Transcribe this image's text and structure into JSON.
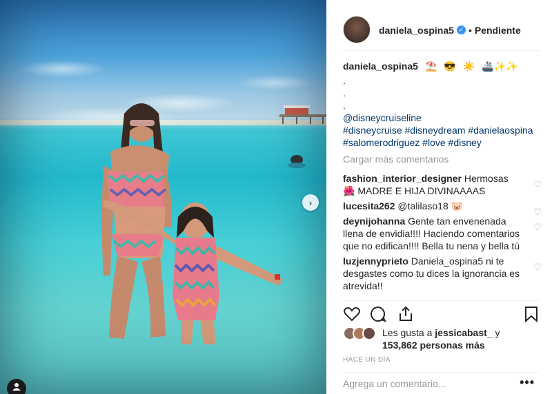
{
  "post": {
    "username": "daniela_ospina5",
    "verified_icon": "verified-badge-icon",
    "follow_state": "Pendiente",
    "caption_emojis": [
      "⛱️",
      "😎",
      "☀️",
      "🚢✨✨"
    ],
    "caption_dots": [
      ".",
      ".",
      "."
    ],
    "caption_lines": [
      "@disneycruiseline",
      "#disneycruise #disneydream #danielaospina",
      "#salomerodriguez #love #disney"
    ],
    "load_more": "Cargar más comentarios",
    "comments": [
      {
        "user": "fashion_interior_designer",
        "text": "Hermosas 🌺 MADRE E HIJA DIVINAAAAS"
      },
      {
        "user": "lucesita262",
        "text": "@talilaso18 🐷"
      },
      {
        "user": "deynijohanna",
        "text": "Gente tan envenenada llena de envidia!!!! Haciendo comentarios que no edifican!!!! Bella tu nena y bella tú"
      },
      {
        "user": "luzjennyprieto",
        "text": "Daniela_ospina5 ni te desgastes como tu dices la ignorancia es atrevida!!"
      }
    ],
    "likes_prefix": "Les gusta a",
    "likes_user": "jessicabast_",
    "likes_joiner": "y",
    "likes_count": "153,862 personas más",
    "time_ago": "HACE UN DÍA",
    "add_comment_placeholder": "Agrega un comentario...",
    "more_options": "•••",
    "next_arrow": "›"
  },
  "colors": {
    "link": "#003569",
    "verified": "#3897f0",
    "muted": "#999999"
  }
}
